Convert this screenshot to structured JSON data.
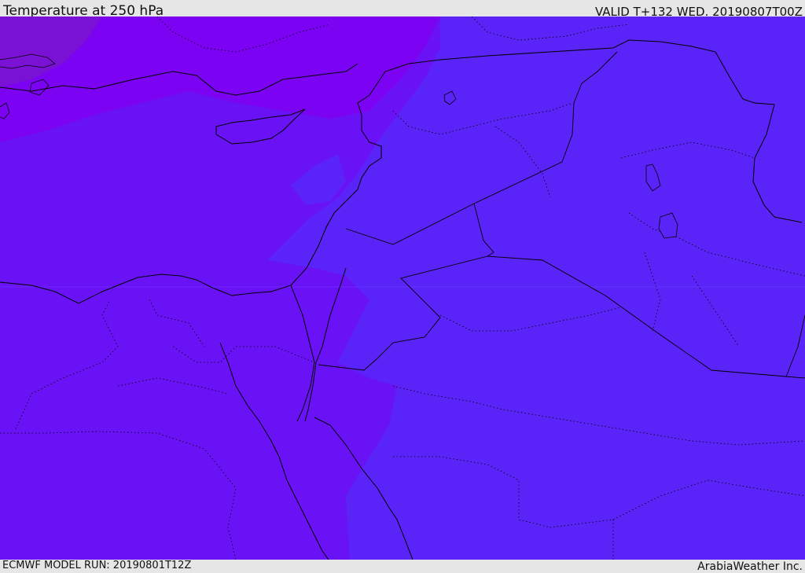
{
  "header": {
    "title": "Temperature at 250 hPa",
    "valid": "VALID T+132 WED. 20190807T00Z"
  },
  "footer": {
    "model_run": "ECMWF MODEL RUN: 20190801T12Z",
    "credit": "ArabiaWeather Inc."
  },
  "colors": {
    "coldest": "#7a10d8",
    "cold": "#7b00f0",
    "mid": "#6a10f5",
    "warm": "#5a23f7",
    "warmest": "#4a30f0",
    "borders": "#000000"
  }
}
